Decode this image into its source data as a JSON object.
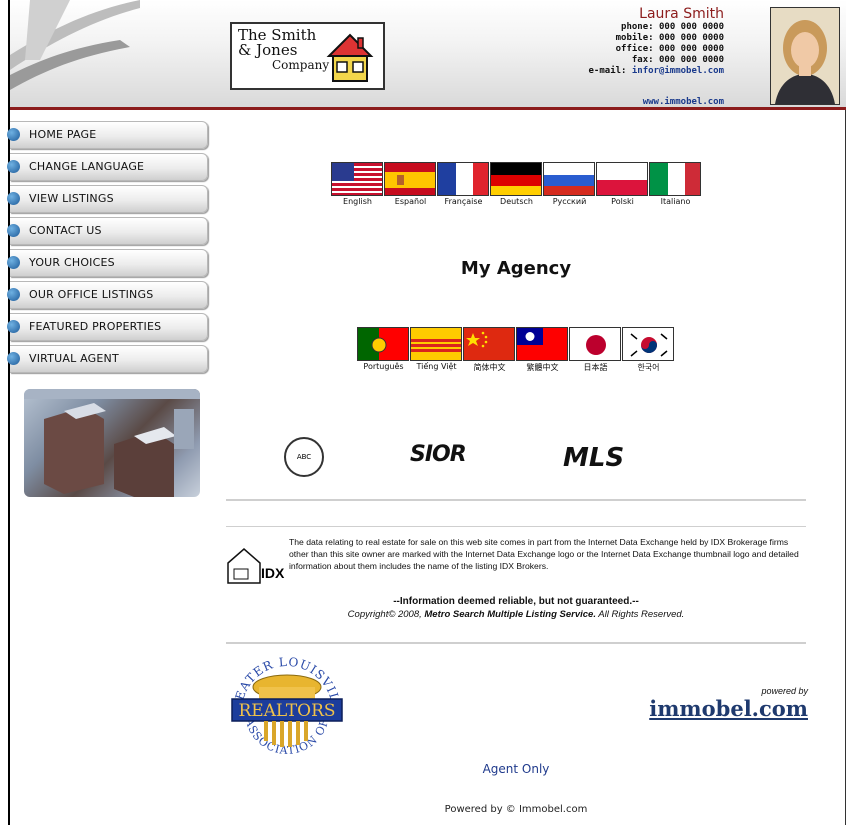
{
  "header": {
    "logo": {
      "line1": "The Smith",
      "line2": "& Jones",
      "line3": "Company"
    },
    "contact": {
      "name": "Laura Smith",
      "phone": "phone: 000 000 0000",
      "mobile": "mobile: 000 000 0000",
      "office": "office: 000 000 0000",
      "fax": "fax: 000 000 0000",
      "email_label": "e-mail:",
      "email": "infor@immobel.com"
    },
    "website": "www.immobel.com"
  },
  "nav": {
    "items": [
      {
        "label": "HOME PAGE"
      },
      {
        "label": "CHANGE LANGUAGE"
      },
      {
        "label": "VIEW LISTINGS"
      },
      {
        "label": "CONTACT US"
      },
      {
        "label": "YOUR CHOICES"
      },
      {
        "label": "OUR OFFICE LISTINGS"
      },
      {
        "label": "FEATURED PROPERTIES"
      },
      {
        "label": "VIRTUAL AGENT"
      }
    ]
  },
  "languages_row1": [
    {
      "label": "English",
      "flag": "us"
    },
    {
      "label": "Español",
      "flag": "es"
    },
    {
      "label": "Française",
      "flag": "fr"
    },
    {
      "label": "Deutsch",
      "flag": "de"
    },
    {
      "label": "Русский",
      "flag": "ru"
    },
    {
      "label": "Polski",
      "flag": "pl"
    },
    {
      "label": "Italiano",
      "flag": "it"
    }
  ],
  "languages_row2": [
    {
      "label": "Português",
      "flag": "pt"
    },
    {
      "label": "Tiếng Việt",
      "flag": "vn"
    },
    {
      "label": "简体中文",
      "flag": "cn"
    },
    {
      "label": "繁體中文",
      "flag": "tw"
    },
    {
      "label": "日本語",
      "flag": "jp"
    },
    {
      "label": "한국어",
      "flag": "kr"
    }
  ],
  "main": {
    "title": "My Agency",
    "badges": {
      "assoc": "ABC",
      "sior": "SIOR",
      "mls": "MLS"
    },
    "idx": {
      "label": "IDX",
      "text": "The data relating to real estate for sale on this web site comes in part from the Internet Data Exchange held by IDX Brokerage firms other than this site owner are marked with the Internet Data Exchange logo or the Internet Data Exchange thumbnail logo and detailed information about them includes the name of the listing IDX Brokers."
    },
    "disclaimer": "--Information deemed reliable, but not guaranteed.--",
    "copyright_prefix": "Copyright© 2008, ",
    "copyright_org": "Metro Search Multiple Listing Service.",
    "copyright_suffix": " All Rights Reserved.",
    "realtors": {
      "text": "REALTORS",
      "arc_top": "GREATER LOUISVILLE",
      "arc_bottom": "ASSOCIATION OF"
    },
    "powered_by_label": "powered by",
    "powered_by_brand": "immobel.com",
    "agent_only": "Agent Only"
  },
  "footer": {
    "text": "Powered by © Immobel.com"
  },
  "colors": {
    "accent_red": "#8c1c1c",
    "link_blue": "#1f3a8c",
    "nav_dot": "#1d5a99"
  }
}
